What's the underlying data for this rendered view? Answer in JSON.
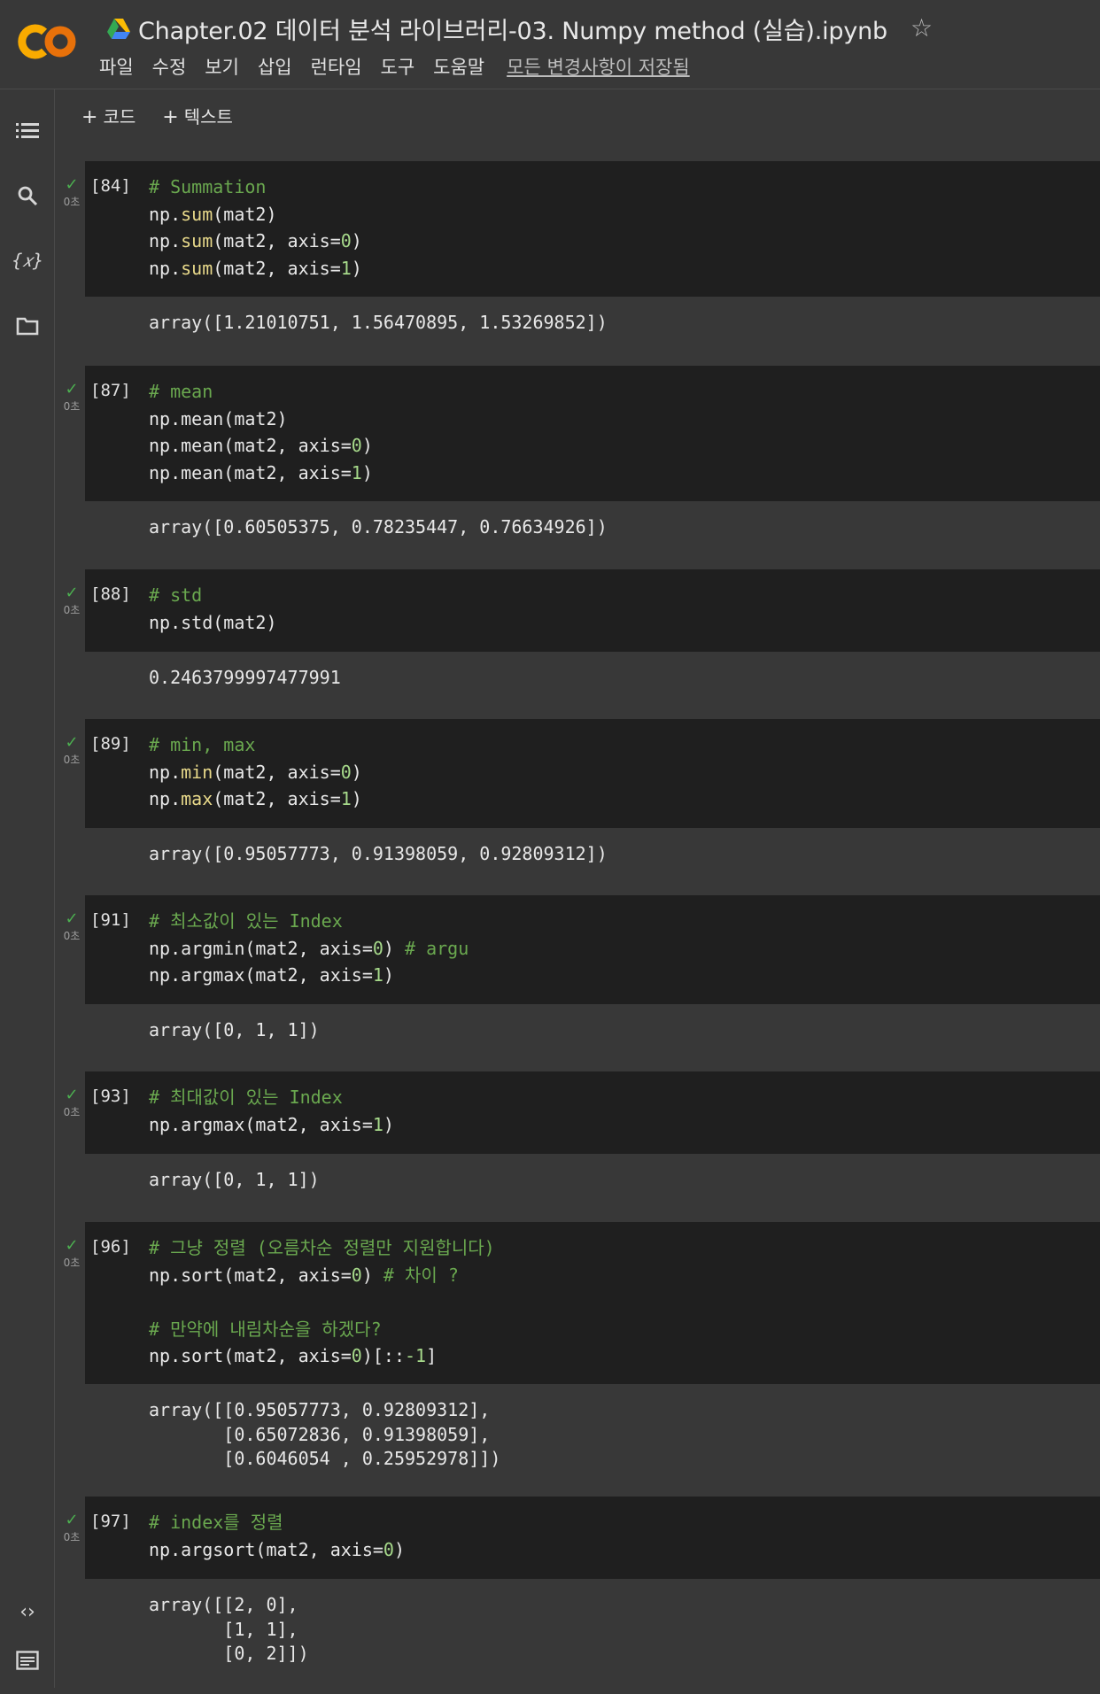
{
  "header": {
    "title": "Chapter.02 데이터 분석 라이브러리-03. Numpy method (실습).ipynb",
    "star_icon": "star-outline-icon",
    "logo": "colab-logo",
    "drive_icon": "google-drive-icon",
    "menus": [
      "파일",
      "수정",
      "보기",
      "삽입",
      "런타임",
      "도구",
      "도움말"
    ],
    "saved_status": "모든 변경사항이 저장됨"
  },
  "toolbar": {
    "add_code": "코드",
    "add_text": "텍스트"
  },
  "sidebar": [
    "table-of-contents-icon",
    "search-icon",
    "variables-icon",
    "files-icon",
    "code-snippets-icon",
    "terminal-icon"
  ],
  "colors": {
    "check": "#4caf50",
    "comment": "#6aa84f",
    "function": "#e8d98a",
    "number": "#a6d98a",
    "cell_bg": "#1f1f1f",
    "page_bg": "#383838"
  },
  "cells": [
    {
      "exec": "[84]",
      "dur": "0초",
      "code": [
        [
          [
            "cm",
            "# Summation"
          ]
        ],
        [
          [
            "",
            "np."
          ],
          [
            "fn",
            "sum"
          ],
          [
            "",
            "(mat2)"
          ]
        ],
        [
          [
            "",
            "np."
          ],
          [
            "fn",
            "sum"
          ],
          [
            "",
            "(mat2, axis="
          ],
          [
            "num",
            "0"
          ],
          [
            "",
            ")"
          ]
        ],
        [
          [
            "",
            "np."
          ],
          [
            "fn",
            "sum"
          ],
          [
            "",
            "(mat2, axis="
          ],
          [
            "num",
            "1"
          ],
          [
            "",
            ")"
          ]
        ]
      ],
      "output": [
        "array([1.21010751, 1.56470895, 1.53269852])"
      ]
    },
    {
      "exec": "[87]",
      "dur": "0초",
      "code": [
        [
          [
            "cm",
            "# mean"
          ]
        ],
        [
          [
            "",
            "np.mean(mat2)"
          ]
        ],
        [
          [
            "",
            "np.mean(mat2, axis="
          ],
          [
            "num",
            "0"
          ],
          [
            "",
            ")"
          ]
        ],
        [
          [
            "",
            "np.mean(mat2, axis="
          ],
          [
            "num",
            "1"
          ],
          [
            "",
            ")"
          ]
        ]
      ],
      "output": [
        "array([0.60505375, 0.78235447, 0.76634926])"
      ]
    },
    {
      "exec": "[88]",
      "dur": "0초",
      "code": [
        [
          [
            "cm",
            "# std"
          ]
        ],
        [
          [
            "",
            "np.std(mat2)"
          ]
        ]
      ],
      "output": [
        "0.2463799997477991"
      ]
    },
    {
      "exec": "[89]",
      "dur": "0초",
      "code": [
        [
          [
            "cm",
            "# min, max"
          ]
        ],
        [
          [
            "",
            "np."
          ],
          [
            "fn",
            "min"
          ],
          [
            "",
            "(mat2, axis="
          ],
          [
            "num",
            "0"
          ],
          [
            "",
            ")"
          ]
        ],
        [
          [
            "",
            "np."
          ],
          [
            "fn",
            "max"
          ],
          [
            "",
            "(mat2, axis="
          ],
          [
            "num",
            "1"
          ],
          [
            "",
            ")"
          ]
        ]
      ],
      "output": [
        "array([0.95057773, 0.91398059, 0.92809312])"
      ]
    },
    {
      "exec": "[91]",
      "dur": "0초",
      "code": [
        [
          [
            "cm",
            "# 최소값이 있는 Index"
          ]
        ],
        [
          [
            "",
            "np.argmin(mat2, axis="
          ],
          [
            "num",
            "0"
          ],
          [
            "",
            ") "
          ],
          [
            "cm",
            "# argu"
          ]
        ],
        [
          [
            "",
            "np.argmax(mat2, axis="
          ],
          [
            "num",
            "1"
          ],
          [
            "",
            ")"
          ]
        ]
      ],
      "output": [
        "array([0, 1, 1])"
      ]
    },
    {
      "exec": "[93]",
      "dur": "0초",
      "code": [
        [
          [
            "cm",
            "# 최대값이 있는 Index"
          ]
        ],
        [
          [
            "",
            "np.argmax(mat2, axis="
          ],
          [
            "num",
            "1"
          ],
          [
            "",
            ")"
          ]
        ]
      ],
      "output": [
        "array([0, 1, 1])"
      ]
    },
    {
      "exec": "[96]",
      "dur": "0초",
      "code": [
        [
          [
            "cm",
            "# 그냥 정렬 (오름차순 정렬만 지원합니다)"
          ]
        ],
        [
          [
            "",
            "np.sort(mat2, axis="
          ],
          [
            "num",
            "0"
          ],
          [
            "",
            ") "
          ],
          [
            "cm",
            "# 차이 ?"
          ]
        ],
        [
          [
            "",
            ""
          ]
        ],
        [
          [
            "cm",
            "# 만약에 내림차순을 하겠다?"
          ]
        ],
        [
          [
            "",
            "np.sort(mat2, axis="
          ],
          [
            "num",
            "0"
          ],
          [
            "",
            ")[::"
          ],
          [
            "num",
            "-1"
          ],
          [
            "",
            "]"
          ]
        ]
      ],
      "output": [
        "array([[0.95057773, 0.92809312],",
        "       [0.65072836, 0.91398059],",
        "       [0.6046054 , 0.25952978]])"
      ]
    },
    {
      "exec": "[97]",
      "dur": "0초",
      "code": [
        [
          [
            "cm",
            "# index를 정렬"
          ]
        ],
        [
          [
            "",
            "np.argsort(mat2, axis="
          ],
          [
            "num",
            "0"
          ],
          [
            "",
            ")"
          ]
        ]
      ],
      "output": [
        "array([[2, 0],",
        "       [1, 1],",
        "       [0, 2]])"
      ]
    }
  ]
}
